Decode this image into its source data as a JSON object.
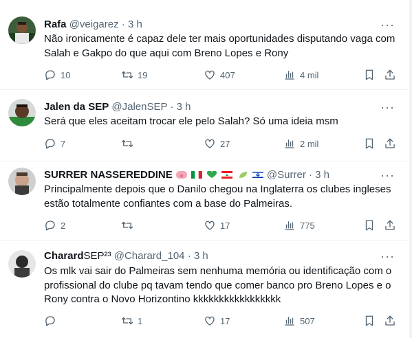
{
  "tweets": [
    {
      "name": "Rafa",
      "handle": "@veigarez",
      "time": "· 3 h",
      "text": "Não ironicamente é capaz dele ter mais oportunidades disputando vaga com Salah e Gakpo do que aqui com Breno Lopes e Rony",
      "replies": "10",
      "retweets": "19",
      "likes": "407",
      "views": "4 mil"
    },
    {
      "name": "Jalen da SEP",
      "handle": "@JalenSEP",
      "time": "· 3 h",
      "text": "Será que eles aceitam trocar ele pelo Salah? Só uma ideia msm",
      "replies": "7",
      "retweets": "",
      "likes": "27",
      "views": "2 mil"
    },
    {
      "name": "SURRER NASSEREDDINE",
      "handle": "@Surrer",
      "time": "· 3 h",
      "text": "Principalmente depois que o Danilo chegou na Inglaterra os clubes ingleses estão totalmente confiantes com a base do Palmeiras.",
      "replies": "2",
      "retweets": "",
      "likes": "17",
      "views": "775"
    },
    {
      "name": "Charard",
      "name_suffix": "SEP²³",
      "handle": "@Charard_104",
      "time": "· 3 h",
      "text": "Os mlk vai sair do Palmeiras sem nenhuma memória ou identificação com o profissional do clube pq tavam tendo que comer banco pro Breno Lopes e o Rony contra o Novo Horizontino kkkkkkkkkkkkkkkkk",
      "replies": "",
      "retweets": "1",
      "likes": "17",
      "views": "507"
    }
  ],
  "more_label": "···",
  "icons": [
    "reply-icon",
    "retweet-icon",
    "like-icon",
    "views-icon",
    "bookmark-icon",
    "share-icon"
  ],
  "colors": {
    "text": "#0f1419",
    "secondary": "#536471",
    "divider": "#eff3f4"
  }
}
